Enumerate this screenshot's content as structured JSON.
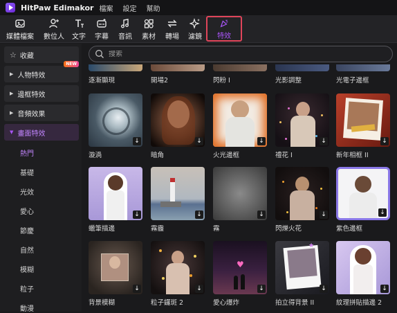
{
  "app": {
    "name": "HitPaw Edimakor",
    "menus": [
      "檔案",
      "設定",
      "幫助"
    ]
  },
  "toolbar": {
    "items": [
      "媒體檔案",
      "數位人",
      "文字",
      "字幕",
      "音訊",
      "素材",
      "轉場",
      "濾鏡",
      "特效"
    ],
    "active": "特效"
  },
  "sidebar": {
    "favorites": "收藏",
    "characters": "人物特效",
    "new_badge": "NEW",
    "border": "邊框特效",
    "audio": "音頻效果",
    "screen": "畫面特效",
    "subs": [
      "熱門",
      "基礎",
      "光效",
      "愛心",
      "節慶",
      "自然",
      "模糊",
      "粒子",
      "動漫"
    ]
  },
  "search": {
    "placeholder": "搜索"
  },
  "top_row": [
    "逐漸顯現",
    "開場2",
    "閃粉 I",
    "光影調整",
    "光電子邊框"
  ],
  "grid": [
    "漩渦",
    "暗角",
    "火光邊框",
    "禮花 I",
    "新年相框 II",
    "蠟筆描邊",
    "霧霾",
    "霧",
    "閃爍火花",
    "紫色邊框",
    "背景模糊",
    "粒子鑼斑 2",
    "愛心爆炸",
    "拍立得背景 II",
    "紋理拼貼描邊 2"
  ],
  "download_glyph": "↓"
}
